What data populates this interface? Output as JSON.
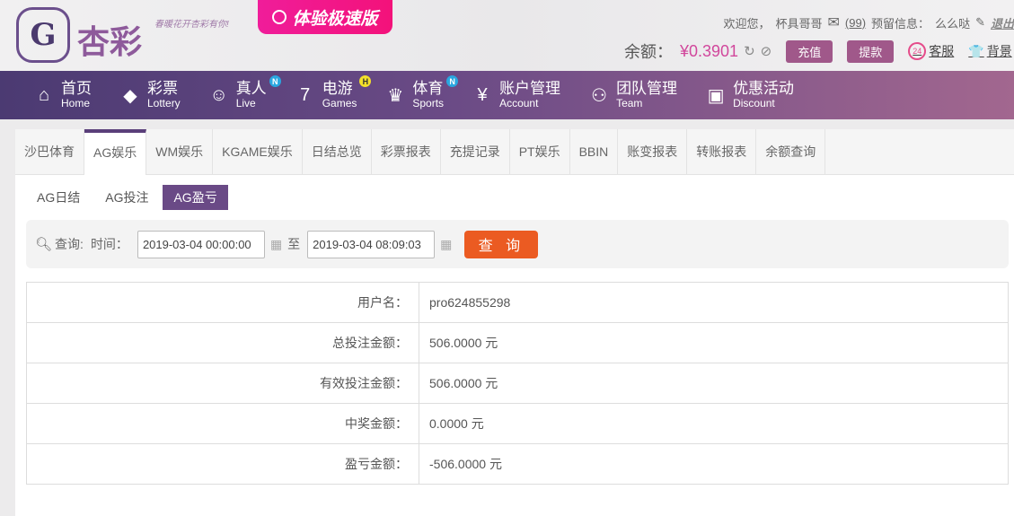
{
  "header": {
    "logo_text": "杏彩",
    "slogan": "春暖花开杏彩有你!",
    "speed_label": "体验极速版",
    "welcome": "欢迎您，",
    "username": "杯具哥哥",
    "msg_count": "(99)",
    "reserved_label": "预留信息：",
    "reserved_value": "么么哒",
    "logout": "退出",
    "balance_label": "余额：",
    "balance_value": "¥0.3901",
    "recharge": "充值",
    "withdraw": "提款",
    "service": "客服",
    "service_badge": "24",
    "background": "背景"
  },
  "nav": [
    {
      "cn": "首页",
      "en": "Home",
      "icon": "home-icon",
      "glyph": "⌂"
    },
    {
      "cn": "彩票",
      "en": "Lottery",
      "icon": "ticket-icon",
      "glyph": "◆"
    },
    {
      "cn": "真人",
      "en": "Live",
      "icon": "woman-icon",
      "glyph": "☺",
      "badge": "N"
    },
    {
      "cn": "电游",
      "en": "Games",
      "icon": "seven-icon",
      "glyph": "7",
      "badge": "H"
    },
    {
      "cn": "体育",
      "en": "Sports",
      "icon": "trophy-icon",
      "glyph": "♛",
      "badge": "N"
    },
    {
      "cn": "账户管理",
      "en": "Account",
      "icon": "yen-icon",
      "glyph": "¥"
    },
    {
      "cn": "团队管理",
      "en": "Team",
      "icon": "team-icon",
      "glyph": "⚇"
    },
    {
      "cn": "优惠活动",
      "en": "Discount",
      "icon": "gift-icon",
      "glyph": "▣"
    }
  ],
  "tabs": [
    "沙巴体育",
    "AG娱乐",
    "WM娱乐",
    "KGAME娱乐",
    "日结总览",
    "彩票报表",
    "充提记录",
    "PT娱乐",
    "BBIN",
    "账变报表",
    "转账报表",
    "余额查询"
  ],
  "active_tab": "AG娱乐",
  "subtabs": [
    "AG日结",
    "AG投注",
    "AG盈亏"
  ],
  "active_subtab": "AG盈亏",
  "query": {
    "label": "查询:",
    "time_label": "时间：",
    "start": "2019-03-04 00:00:00",
    "to": "至",
    "end": "2019-03-04 08:09:03",
    "button": "查 询"
  },
  "rows": [
    {
      "label": "用户名：",
      "value": "pro624855298"
    },
    {
      "label": "总投注金额：",
      "value": "506.0000 元"
    },
    {
      "label": "有效投注金额：",
      "value": "506.0000 元"
    },
    {
      "label": "中奖金额：",
      "value": "0.0000 元"
    },
    {
      "label": "盈亏金额：",
      "value": "-506.0000 元"
    }
  ]
}
